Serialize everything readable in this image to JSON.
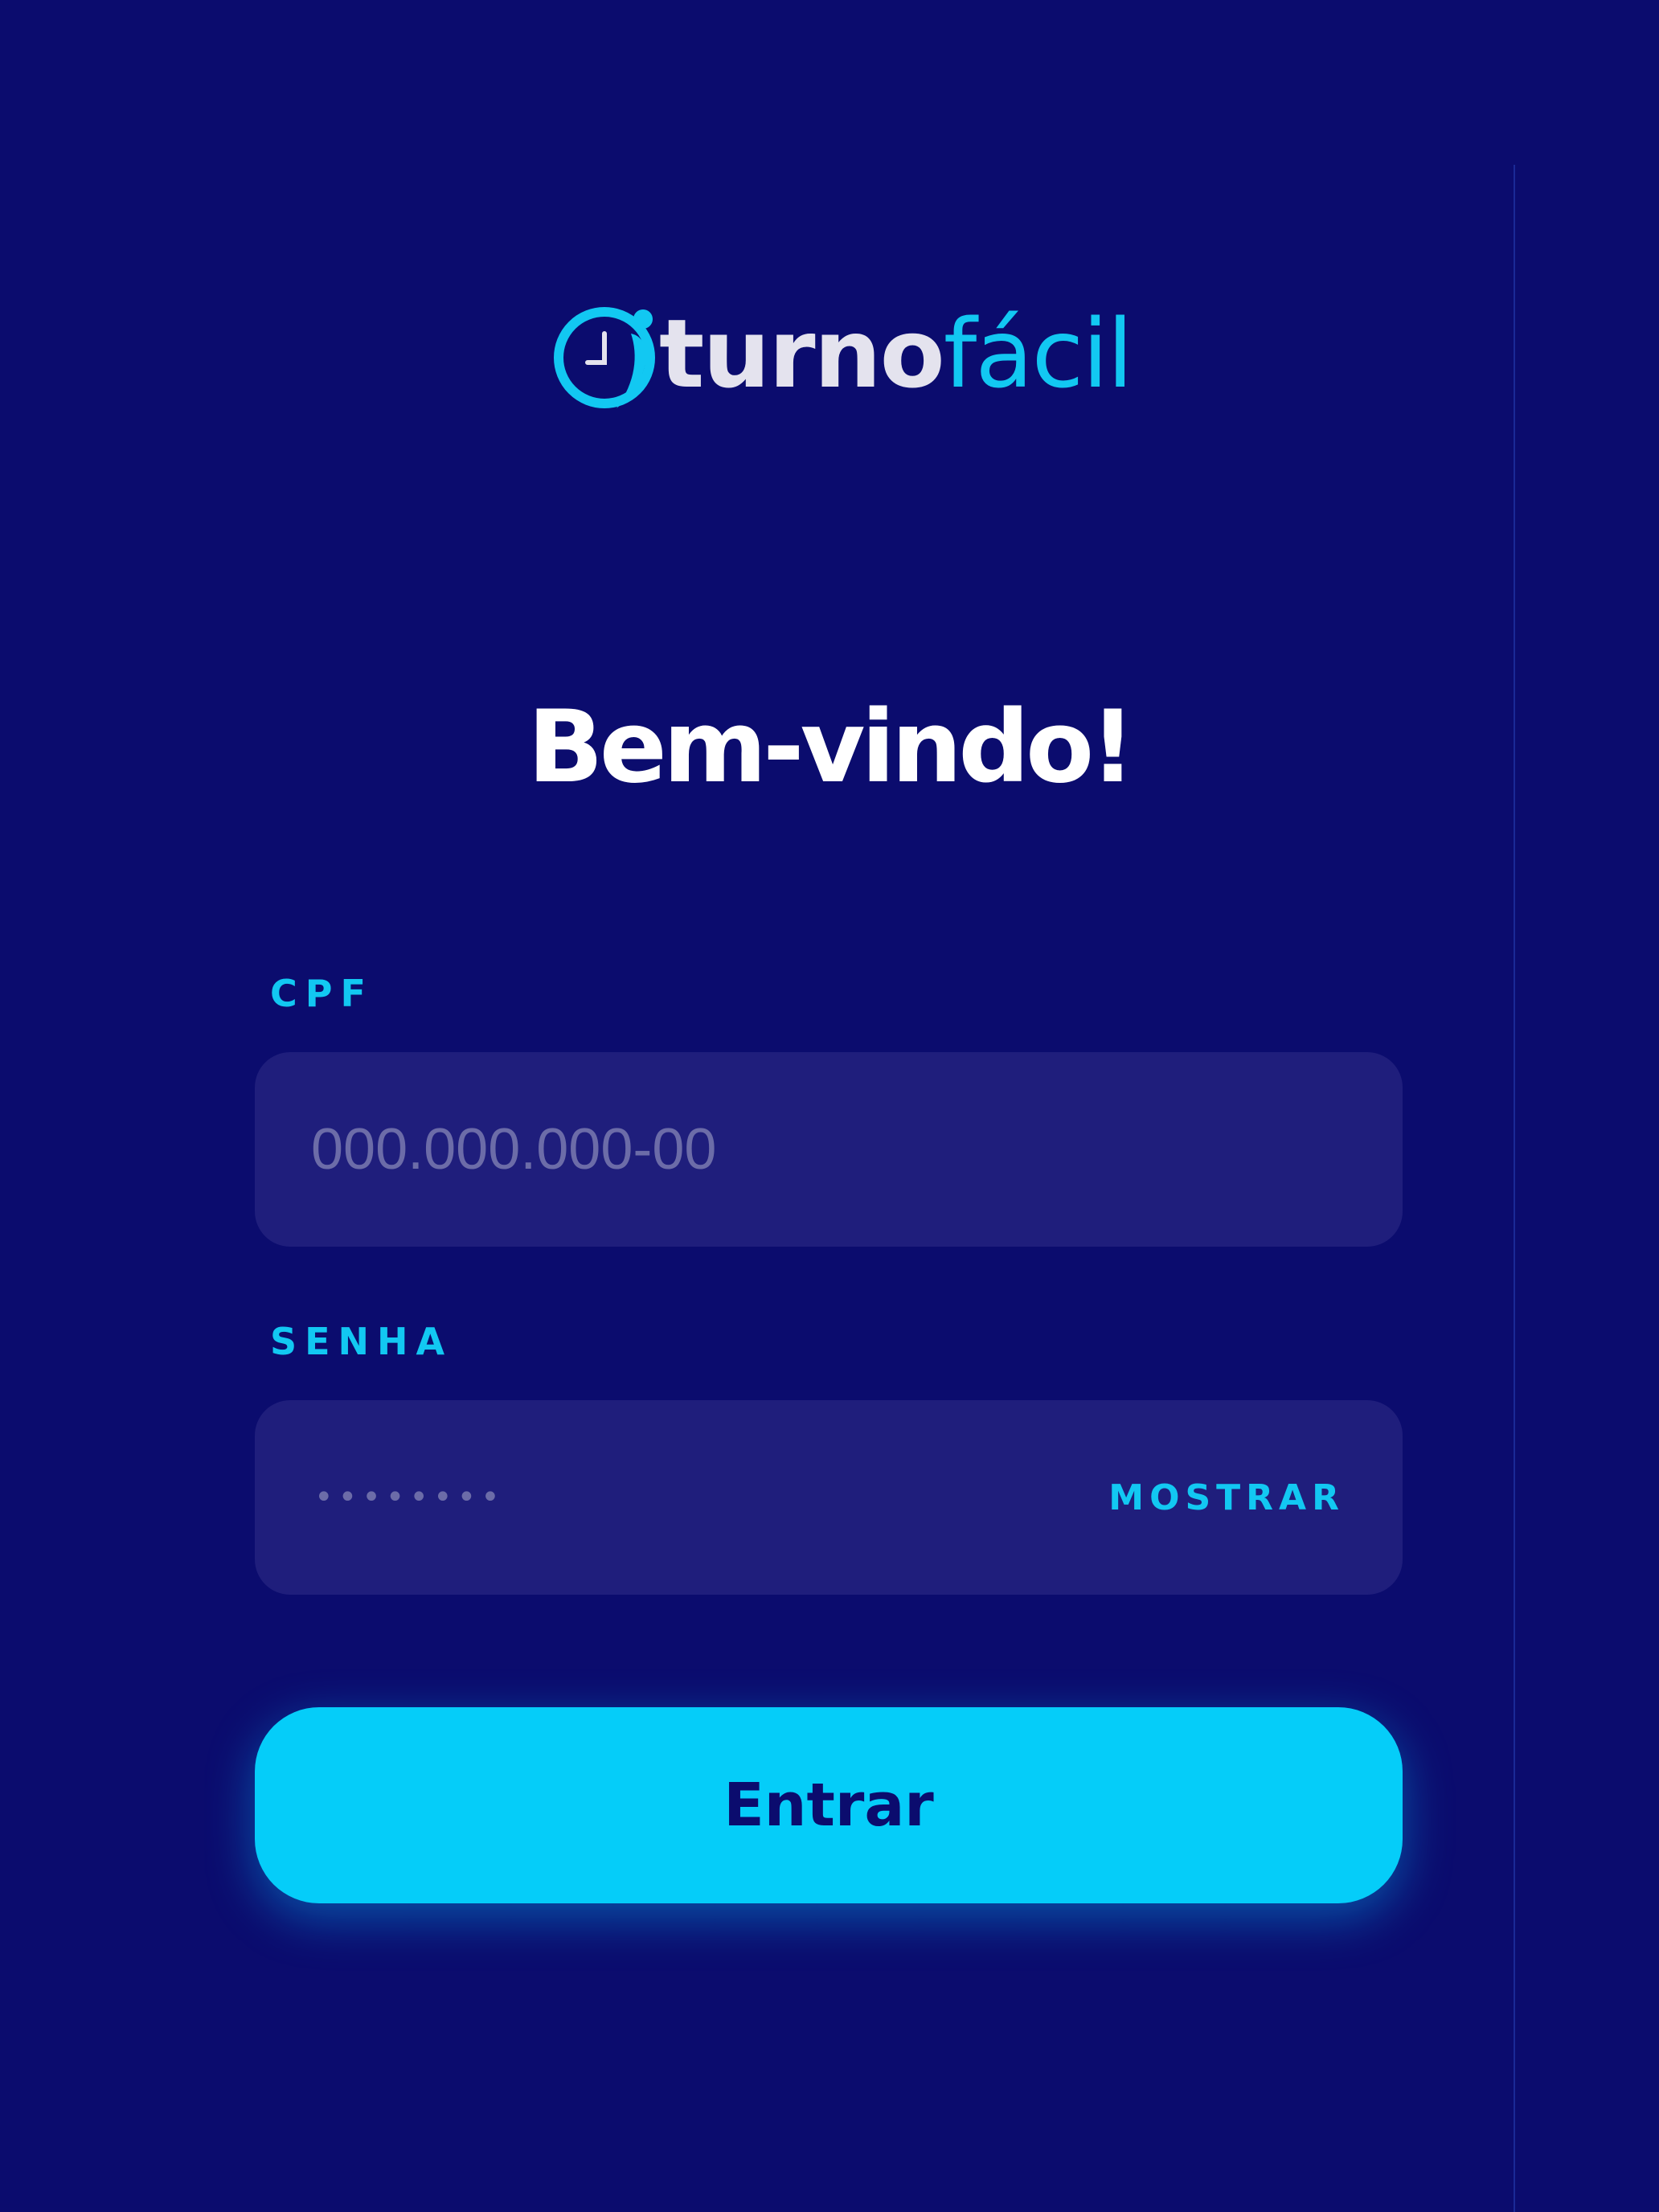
{
  "brand": {
    "logo_icon": "clock-person-icon",
    "name_part1": "turno",
    "name_part2": "fácil",
    "accent_color": "#12c8f2"
  },
  "title": "Bem-vindo!",
  "cpf": {
    "label": "CPF",
    "placeholder": "000.000.000-00",
    "value": ""
  },
  "password": {
    "label": "SENHA",
    "masked_value": "••••••••",
    "toggle_label": "MOSTRAR"
  },
  "submit": {
    "label": "Entrar",
    "color": "#05cdf9"
  },
  "colors": {
    "background": "#0b0c6e",
    "field_background": "#1f1e7c",
    "title": "#ffffff"
  }
}
